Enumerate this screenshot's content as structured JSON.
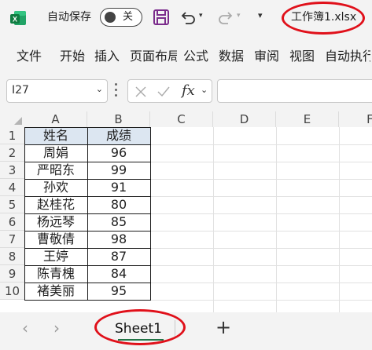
{
  "title_bar": {
    "autosave_label": "自动保存",
    "autosave_state": "关",
    "file_name": "工作簿1.xlsx"
  },
  "ribbon": {
    "tabs": [
      "文件",
      "开始",
      "插入",
      "页面布局",
      "公式",
      "数据",
      "审阅",
      "视图",
      "自动执行"
    ]
  },
  "formula_bar": {
    "name_box": "I27",
    "fx_label": "fx",
    "formula": ""
  },
  "grid": {
    "columns": [
      "A",
      "B",
      "C",
      "D",
      "E",
      "F"
    ],
    "rows": [
      "1",
      "2",
      "3",
      "4",
      "5",
      "6",
      "7",
      "8",
      "9",
      "10"
    ],
    "cells": [
      [
        "姓名",
        "成绩"
      ],
      [
        "周娟",
        "96"
      ],
      [
        "严昭东",
        "99"
      ],
      [
        "孙欢",
        "91"
      ],
      [
        "赵桂花",
        "80"
      ],
      [
        "杨远琴",
        "85"
      ],
      [
        "曹敬倩",
        "98"
      ],
      [
        "王婷",
        "87"
      ],
      [
        "陈青槐",
        "84"
      ],
      [
        "褚美丽",
        "95"
      ]
    ],
    "header_fill": "#dce6f1"
  },
  "sheets": {
    "tabs": [
      "Sheet1"
    ],
    "active": "Sheet1",
    "nav_prev": "‹",
    "nav_next": "›",
    "add_label": "+"
  },
  "colors": {
    "accent": "#217346",
    "annotation": "#e0101a",
    "save_icon": "#7b2c8c"
  }
}
